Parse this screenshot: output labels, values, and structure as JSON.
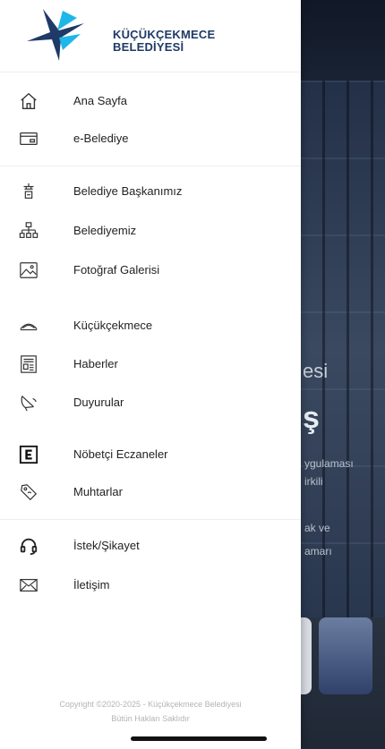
{
  "logo": {
    "line1": "KÜÇÜKÇEKMECE",
    "line2": "BELEDİYESİ"
  },
  "menu": [
    {
      "label": "Ana Sayfa",
      "icon": "home-icon"
    },
    {
      "label": "e-Belediye",
      "icon": "card-icon"
    },
    {
      "label": "Belediye Başkanımız",
      "icon": "mayor-icon"
    },
    {
      "label": "Belediyemiz",
      "icon": "org-chart-icon"
    },
    {
      "label": "Fotoğraf Galerisi",
      "icon": "image-icon"
    },
    {
      "label": "Küçükçekmece",
      "icon": "bridge-icon"
    },
    {
      "label": "Haberler",
      "icon": "newspaper-icon"
    },
    {
      "label": "Duyurular",
      "icon": "megaphone-icon"
    },
    {
      "label": "Nöbetçi Eczaneler",
      "icon": "pharmacy-icon"
    },
    {
      "label": "Muhtarlar",
      "icon": "location-tag-icon"
    },
    {
      "label": "İstek/Şikayet",
      "icon": "headset-icon"
    },
    {
      "label": "İletişim",
      "icon": "mail-icon"
    }
  ],
  "background": {
    "sub": "esi",
    "big": "ş",
    "lines": [
      "ygulaması",
      "irkili",
      "ak ve",
      "amarı"
    ]
  },
  "footer": {
    "copyright_line1": "Copyright ©2020-2025 - Küçükçekmece Belediyesi",
    "copyright_line2": "Bütün Hakları Saklıdır"
  },
  "colors": {
    "brand_blue": "#1f3a66",
    "accent_cyan": "#1fb6e8"
  }
}
